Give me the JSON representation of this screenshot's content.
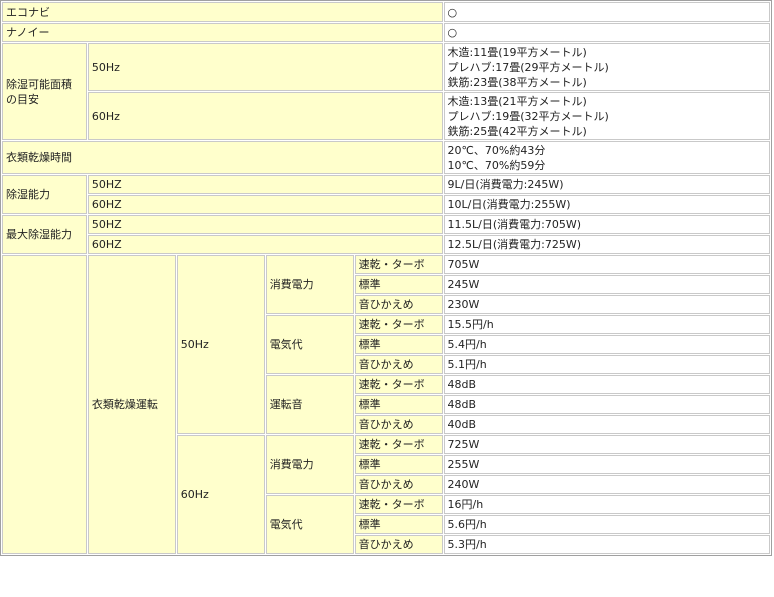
{
  "rows": {
    "econavi": {
      "label": "エコナビ",
      "value": "○"
    },
    "nanoe": {
      "label": "ナノイー",
      "value": "○"
    },
    "area": {
      "label": "除湿可能面積の目安",
      "hz50": {
        "label": "50Hz",
        "lines": [
          "木造:11畳(19平方メートル)",
          "プレハブ:17畳(29平方メートル)",
          "鉄筋:23畳(38平方メートル)"
        ]
      },
      "hz60": {
        "label": "60Hz",
        "lines": [
          "木造:13畳(21平方メートル)",
          "プレハブ:19畳(32平方メートル)",
          "鉄筋:25畳(42平方メートル)"
        ]
      }
    },
    "drying_time": {
      "label": "衣類乾燥時間",
      "lines": [
        "20℃、70%約43分",
        "10℃、70%約59分"
      ]
    },
    "capacity": {
      "label": "除湿能力",
      "hz50": {
        "label": "50HZ",
        "value": "9L/日(消費電力:245W)"
      },
      "hz60": {
        "label": "60HZ",
        "value": "10L/日(消費電力:255W)"
      }
    },
    "max_capacity": {
      "label": "最大除湿能力",
      "hz50": {
        "label": "50HZ",
        "value": "11.5L/日(消費電力:705W)"
      },
      "hz60": {
        "label": "60HZ",
        "value": "12.5L/日(消費電力:725W)"
      }
    },
    "clothes_drying": {
      "label": "衣類乾燥運転",
      "hz50": {
        "label": "50Hz",
        "power": {
          "label": "消費電力",
          "modes": [
            {
              "mode": "速乾・ターボ",
              "value": "705W"
            },
            {
              "mode": "標準",
              "value": "245W"
            },
            {
              "mode": "音ひかえめ",
              "value": "230W"
            }
          ]
        },
        "cost": {
          "label": "電気代",
          "modes": [
            {
              "mode": "速乾・ターボ",
              "value": "15.5円/h"
            },
            {
              "mode": "標準",
              "value": "5.4円/h"
            },
            {
              "mode": "音ひかえめ",
              "value": "5.1円/h"
            }
          ]
        },
        "noise": {
          "label": "運転音",
          "modes": [
            {
              "mode": "速乾・ターボ",
              "value": "48dB"
            },
            {
              "mode": "標準",
              "value": "48dB"
            },
            {
              "mode": "音ひかえめ",
              "value": "40dB"
            }
          ]
        }
      },
      "hz60": {
        "label": "60Hz",
        "power": {
          "label": "消費電力",
          "modes": [
            {
              "mode": "速乾・ターボ",
              "value": "725W"
            },
            {
              "mode": "標準",
              "value": "255W"
            },
            {
              "mode": "音ひかえめ",
              "value": "240W"
            }
          ]
        },
        "cost": {
          "label": "電気代",
          "modes": [
            {
              "mode": "速乾・ターボ",
              "value": "16円/h"
            },
            {
              "mode": "標準",
              "value": "5.6円/h"
            },
            {
              "mode": "音ひかえめ",
              "value": "5.3円/h"
            }
          ]
        }
      }
    }
  }
}
